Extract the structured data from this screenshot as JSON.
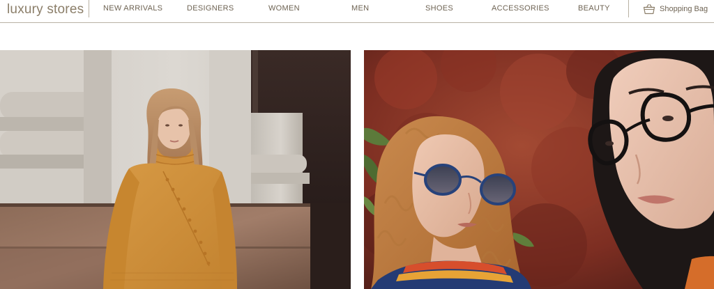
{
  "brand": {
    "logo_text": "luxury stores"
  },
  "nav": {
    "items": [
      {
        "label": "NEW ARRIVALS"
      },
      {
        "label": "DESIGNERS"
      },
      {
        "label": "WOMEN"
      },
      {
        "label": "MEN"
      },
      {
        "label": "SHOES"
      },
      {
        "label": "ACCESSORIES"
      },
      {
        "label": "BEAUTY"
      }
    ]
  },
  "cart": {
    "label": "Shopping Bag",
    "icon": "shopping-bag-icon"
  },
  "colors": {
    "accent": "#8b7e69",
    "nav_text": "#6e6353",
    "divider": "#b9b1a3",
    "sweater_mustard": "#d3953e",
    "foliage_red": "#8e3526"
  }
}
